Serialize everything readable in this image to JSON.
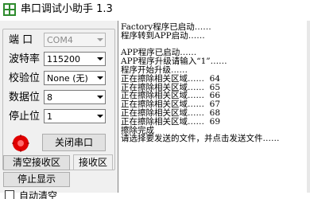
{
  "window": {
    "title": "串口调试小助手 1.3",
    "icon": "green-white-grid-app-icon"
  },
  "settings": {
    "port_label": "端 口",
    "port_value": "COM4",
    "baud_label": "波特率",
    "baud_value": "115200",
    "parity_label": "校验位",
    "parity_value": "None (无)",
    "data_bits_label": "数据位",
    "data_bits_value": "8",
    "stop_bits_label": "停止位",
    "stop_bits_value": "1"
  },
  "status": {
    "indicator_color": "#e00000",
    "indicator_icon": "red-lamp-icon"
  },
  "buttons": {
    "close_port": "关闭串口",
    "clear_receive": "清空接收区",
    "receive_area": "接收区",
    "stop_display": "停止显示",
    "auto_clear": "自动清空"
  },
  "receive": {
    "lines": [
      "Factory程序已启动……",
      "程序转到APP启动……",
      "",
      "APP程序已启动……",
      "APP程序升级请输入“1”……",
      "程序开始升级……",
      "正在擦除相关区域……  64",
      "正在擦除相关区域……  65",
      "正在擦除相关区域……  66",
      "正在擦除相关区域……  67",
      "正在擦除相关区域……  68",
      "正在擦除相关区域……  69",
      "擦除完成",
      "请选择要发送的文件，并点击发送文件……"
    ]
  }
}
